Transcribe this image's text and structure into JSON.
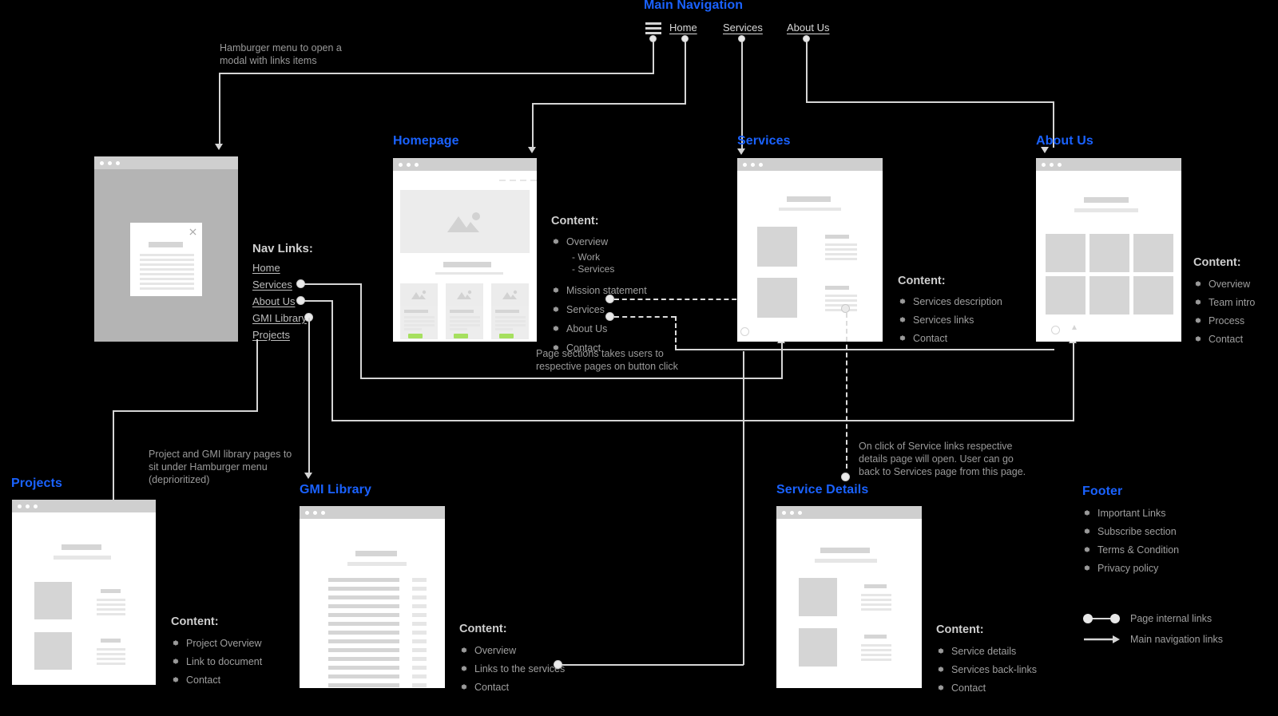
{
  "diagram": {
    "title_main_navigation": "Main Navigation",
    "top_nav": {
      "hamburger_icon": "hamburger-icon",
      "items": [
        "Home",
        "Services",
        "About Us"
      ]
    },
    "notes": {
      "hamburger": "Hamburger menu to open a\nmodal with links items",
      "page_sections": "Page sections takes users to\nrespective pages on button click",
      "projects_gmi": "Project and GMI library pages to\nsit under Hamburger menu\n(deprioritized)",
      "service_details": "On click of Service links respective\ndetails page will open. User can go\nback to Services page from this page."
    },
    "nav_links": {
      "heading": "Nav Links:",
      "items": [
        "Home",
        "Services",
        "About Us",
        "GMI Library",
        "Projects"
      ]
    },
    "pages": {
      "homepage": {
        "title": "Homepage",
        "content_heading": "Content:",
        "items": [
          "Overview",
          "Mission statement",
          "Services",
          "About Us",
          "Contact"
        ],
        "sub_items": [
          "- Work",
          "- Services"
        ]
      },
      "services": {
        "title": "Services",
        "content_heading": "Content:",
        "items": [
          "Services description",
          "Services links",
          "Contact"
        ]
      },
      "about_us": {
        "title": "About Us",
        "content_heading": "Content:",
        "items": [
          "Overview",
          "Team intro",
          "Process",
          "Contact"
        ]
      },
      "projects": {
        "title": "Projects",
        "content_heading": "Content:",
        "items": [
          "Project Overview",
          "Link to document",
          "Contact"
        ]
      },
      "gmi_library": {
        "title": "GMI Library",
        "content_heading": "Content:",
        "items": [
          "Overview",
          "Links to the services",
          "Contact"
        ]
      },
      "service_details": {
        "title": "Service Details",
        "content_heading": "Content:",
        "items": [
          "Service details",
          "Services back-links",
          "Contact"
        ]
      }
    },
    "footer": {
      "title": "Footer",
      "items": [
        "Important Links",
        "Subscribe section",
        "Terms & Condition",
        "Privacy policy"
      ]
    },
    "legend": {
      "internal": "Page internal links",
      "main_nav": "Main navigation links"
    },
    "colors": {
      "background": "#000000",
      "accent": "#1a62ff",
      "line": "#d5d5d5",
      "text": "#9f9f9f",
      "mock_chrome": "#cfcfcf",
      "button_green": "#a6e05f"
    }
  }
}
